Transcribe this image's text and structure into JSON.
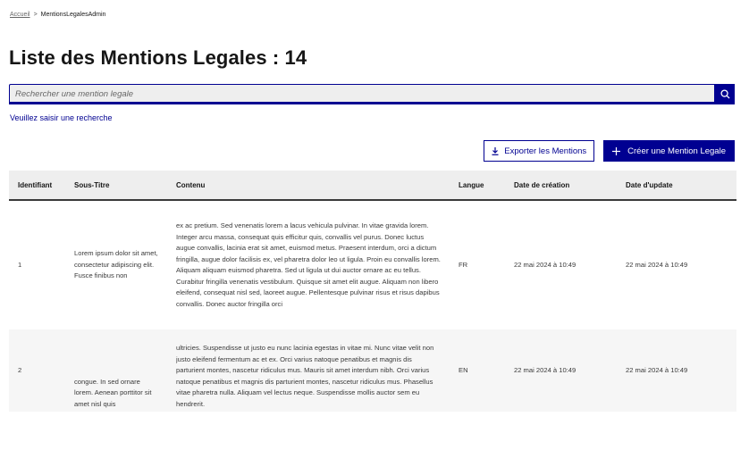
{
  "breadcrumb": {
    "home": "Accueil",
    "separator": ">",
    "current": "MentionsLegalesAdmin"
  },
  "page_title": "Liste des Mentions Legales : 14",
  "search": {
    "placeholder": "Rechercher une mention legale",
    "value": "",
    "button_icon": "search-icon"
  },
  "hint": "Veuillez saisir une recherche",
  "actions": {
    "export_label": "Exporter les Mentions",
    "export_icon": "download-icon",
    "create_label": "Créer une Mention Legale",
    "create_icon": "plus-icon"
  },
  "colors": {
    "primary": "#000091",
    "header_bg": "#eeeeee",
    "row_alt_bg": "#f6f6f6"
  },
  "table": {
    "columns": [
      "Identifiant",
      "Sous-Titre",
      "Contenu",
      "Langue",
      "Date de création",
      "Date d'update"
    ],
    "rows": [
      {
        "id": "1",
        "subtitle": "Lorem ipsum dolor sit amet, consectetur adipiscing elit. Fusce finibus non",
        "content": "ex ac pretium. Sed venenatis lorem a lacus vehicula pulvinar. In vitae gravida lorem. Integer arcu massa, consequat quis efficitur quis, convallis vel purus. Donec luctus augue convallis, lacinia erat sit amet, euismod metus. Praesent interdum, orci a dictum fringilla, augue dolor facilisis ex, vel pharetra dolor leo ut ligula. Proin eu convallis lorem. Aliquam aliquam euismod pharetra. Sed ut ligula ut dui auctor ornare ac eu tellus. Curabitur fringilla venenatis vestibulum. Quisque sit amet elit augue. Aliquam non libero eleifend, consequat nisl sed, laoreet augue. Pellentesque pulvinar risus et risus dapibus convallis. Donec auctor fringilla orci",
        "lang": "FR",
        "created": "22 mai 2024 à 10:49",
        "updated": "22 mai 2024 à 10:49"
      },
      {
        "id": "2",
        "subtitle": "congue. In sed ornare lorem. Aenean porttitor sit amet nisl quis",
        "content": "ultricies. Suspendisse ut justo eu nunc lacinia egestas in vitae mi. Nunc vitae velit non justo eleifend fermentum ac et ex. Orci varius natoque penatibus et magnis dis parturient montes, nascetur ridiculus mus. Mauris sit amet interdum nibh. Orci varius natoque penatibus et magnis dis parturient montes, nascetur ridiculus mus. Phasellus vitae pharetra nulla. Aliquam vel lectus neque. Suspendisse mollis auctor sem eu hendrerit.",
        "lang": "EN",
        "created": "22 mai 2024 à 10:49",
        "updated": "22 mai 2024 à 10:49"
      }
    ]
  }
}
